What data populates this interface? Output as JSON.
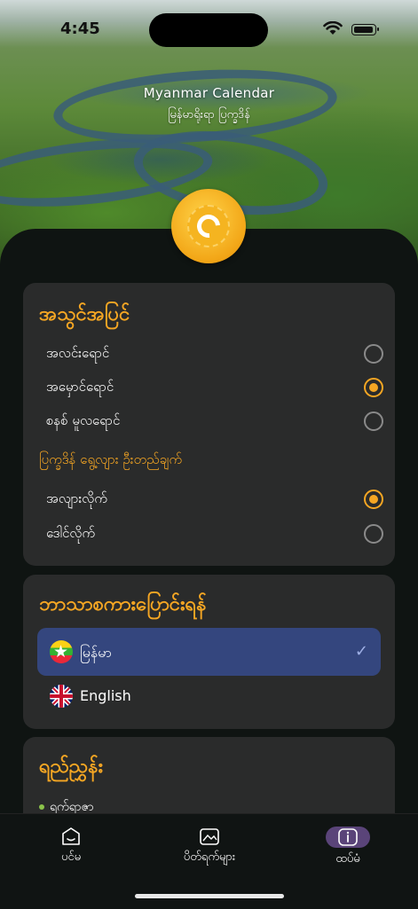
{
  "status_bar": {
    "time": "4:45"
  },
  "header": {
    "title": "Myanmar Calendar",
    "subtitle": "မြန်မာရိုးရာ ပြက္ခဒိန်"
  },
  "theme_section": {
    "title": "အသွင်အပြင်",
    "options": [
      {
        "label": "အလင်းရောင်",
        "selected": false
      },
      {
        "label": "အမှောင်ရောင်",
        "selected": true
      },
      {
        "label": "စနစ် မူလရောင်",
        "selected": false
      }
    ],
    "sub_title": "ပြက္ခဒိန် ရွေ့လျား ဦးတည်ချက်",
    "direction_options": [
      {
        "label": "အလျားလိုက်",
        "selected": true
      },
      {
        "label": "ဒေါင်လိုက်",
        "selected": false
      }
    ]
  },
  "language_section": {
    "title": "ဘာသာစကားပြောင်းရန်",
    "languages": [
      {
        "label": "မြန်မာ",
        "selected": true,
        "flag": "myanmar-flag"
      },
      {
        "label": "English",
        "selected": false,
        "flag": "uk-flag"
      }
    ],
    "check_glyph": "✓"
  },
  "links_section": {
    "title": "ရည်ညွှန်း",
    "items": [
      {
        "label": "ရက်ရာဇာ"
      }
    ]
  },
  "tab_bar": {
    "tabs": [
      {
        "label": "ပင်မ",
        "icon": "home-icon",
        "active": false
      },
      {
        "label": "ပိတ်ရက်များ",
        "icon": "holiday-icon",
        "active": false
      },
      {
        "label": "ထပ်မံ",
        "icon": "info-icon",
        "active": true
      }
    ]
  },
  "colors": {
    "accent": "#f5a623",
    "card": "#2a2b2b",
    "selected_language": "#34467e",
    "active_tab_pill": "#5a4479",
    "background": "#0f1412"
  }
}
